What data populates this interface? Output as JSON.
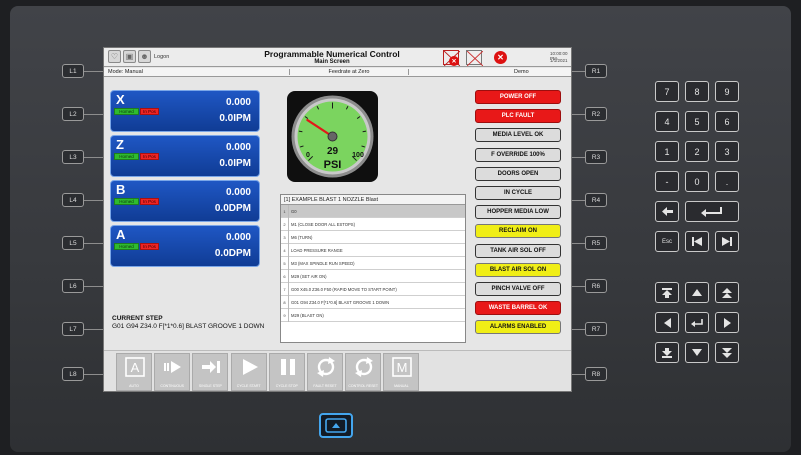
{
  "top_bar": {
    "logon_label": "Logon",
    "title": "Programmable Numerical Control",
    "subtitle": "Main Screen",
    "clock_time": "10:00:00 PM",
    "clock_date": "1/1/2021"
  },
  "status_bar": {
    "mode": "Mode: Manual",
    "feedrate": "Feedrate at Zero",
    "state": "Demo"
  },
  "axes": [
    {
      "name": "X",
      "homed": "Homed",
      "in_pos": "In Pos",
      "value": "0.000",
      "unit": "0.0IPM"
    },
    {
      "name": "Z",
      "homed": "Homed",
      "in_pos": "In Pos",
      "value": "0.000",
      "unit": "0.0IPM"
    },
    {
      "name": "B",
      "homed": "Homed",
      "in_pos": "In Pos",
      "value": "0.000",
      "unit": "0.0DPM"
    },
    {
      "name": "A",
      "homed": "Homed",
      "in_pos": "In Pos",
      "value": "0.000",
      "unit": "0.0DPM"
    }
  ],
  "current_step": {
    "label": "CURRENT STEP",
    "text": "G01 G94 Z34.0 F[*1*0.6] BLAST GROOVE 1 DOWN"
  },
  "gauge": {
    "value": "29",
    "unit": "PSI",
    "min_label": "0",
    "max_label": "100",
    "max": 100
  },
  "step_list": {
    "title": "[1] EXAMPLE BLAST 1 NOZZLE Blast",
    "rows": [
      {
        "num": "1",
        "text": "G0"
      },
      {
        "num": "2",
        "text": "M1 (CLOSE DOOR ALL ESTOPS)"
      },
      {
        "num": "3",
        "text": "M6 (TURN)"
      },
      {
        "num": "4",
        "text": "LOAD PRESSURE RANGE"
      },
      {
        "num": "5",
        "text": "M3 (MAX SPINDLE RUN SPEED)"
      },
      {
        "num": "6",
        "text": "M29 (SET AIR ON)"
      },
      {
        "num": "7",
        "text": "G00 X45.0 Z36.0 F50 (RAPID MOVE TO START POINT)"
      },
      {
        "num": "8",
        "text": "G01 G94 Z34.0 F[*1*0.6] BLAST GROOVE 1 DOWN"
      },
      {
        "num": "9",
        "text": "M29 (BLAST ON)"
      }
    ]
  },
  "status_buttons": [
    {
      "label": "POWER OFF",
      "style": "red"
    },
    {
      "label": "PLC FAULT",
      "style": "red"
    },
    {
      "label": "MEDIA LEVEL OK",
      "style": "grey"
    },
    {
      "label": "F OVERRIDE 100%",
      "style": "grey"
    },
    {
      "label": "DOORS OPEN",
      "style": "grey"
    },
    {
      "label": "IN CYCLE",
      "style": "grey"
    },
    {
      "label": "HOPPER MEDIA LOW",
      "style": "grey"
    },
    {
      "label": "RECLAIM ON",
      "style": "yellow"
    },
    {
      "label": "TANK AIR SOL OFF",
      "style": "grey"
    },
    {
      "label": "BLAST AIR SOL ON",
      "style": "yellow"
    },
    {
      "label": "PINCH VALVE OFF",
      "style": "grey"
    },
    {
      "label": "WASTE BARREL OK",
      "style": "red"
    },
    {
      "label": "ALARMS ENABLED",
      "style": "yellow"
    }
  ],
  "toolbar": [
    {
      "label": "AUTO",
      "icon": "auto-icon"
    },
    {
      "label": "CONTINUOUS",
      "icon": "continuous-icon"
    },
    {
      "label": "SINGLE STEP",
      "icon": "single-step-icon"
    },
    {
      "label": "CYCLE START",
      "icon": "play-icon"
    },
    {
      "label": "CYCLE STOP",
      "icon": "pause-icon"
    },
    {
      "label": "FAULT RESET",
      "icon": "reset-icon"
    },
    {
      "label": "CONTROL RESET",
      "icon": "control-reset-icon"
    },
    {
      "label": "MANUAL",
      "icon": "manual-icon"
    }
  ],
  "side_keys_left": [
    "L1",
    "L2",
    "L3",
    "L4",
    "L5",
    "L6",
    "L7",
    "L8"
  ],
  "side_keys_right": [
    "R1",
    "R2",
    "R3",
    "R4",
    "R5",
    "R6",
    "R7",
    "R8"
  ],
  "keypad": {
    "digits": [
      "7",
      "8",
      "9",
      "4",
      "5",
      "6",
      "1",
      "2",
      "3",
      "-",
      "0",
      "."
    ],
    "esc_label": "Esc"
  },
  "colors": {
    "axis_panel": "#1f57c4",
    "gauge_face": "#7bd45f",
    "status_red": "#e81818",
    "status_yellow": "#f0ee16",
    "home_button": "#44a6ee"
  }
}
